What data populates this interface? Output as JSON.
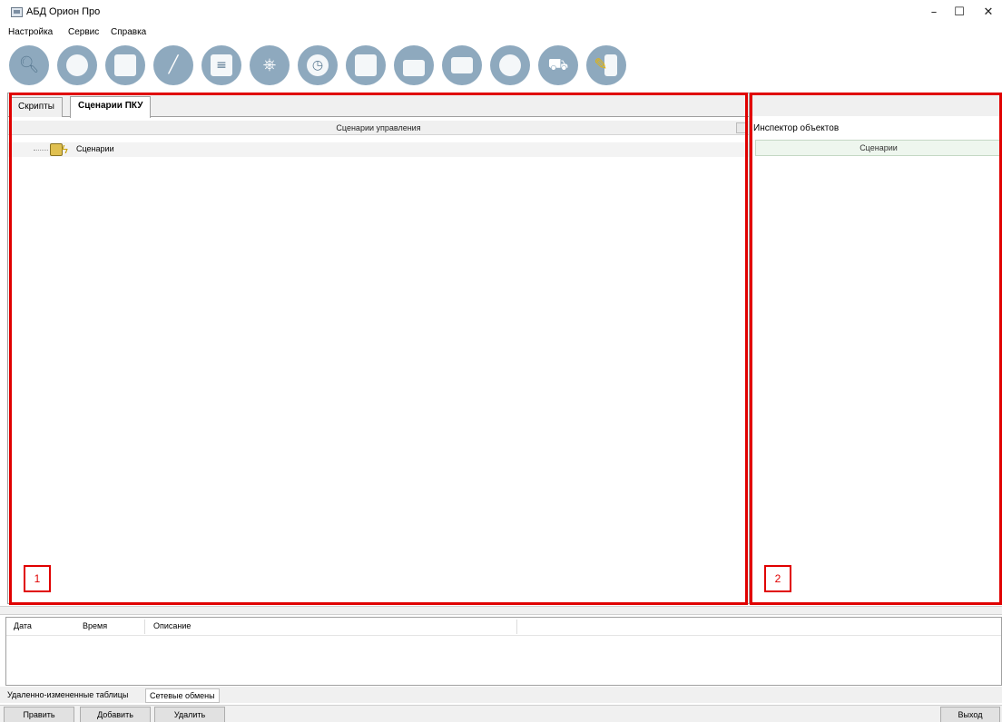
{
  "window": {
    "title": "АБД Орион Про",
    "icon": "database-icon",
    "controls": {
      "minimize": "–",
      "maximize": "☐",
      "close": "✕"
    }
  },
  "menu": {
    "items": [
      {
        "label": "Настройка"
      },
      {
        "label": "Сервис"
      },
      {
        "label": "Справка"
      }
    ]
  },
  "toolbar": {
    "buttons": [
      {
        "icon": "search-icon"
      },
      {
        "icon": "cards-icon"
      },
      {
        "icon": "devices-icon"
      },
      {
        "icon": "barrier-icon"
      },
      {
        "icon": "document-list-icon",
        "active": true
      },
      {
        "icon": "wheel-icon"
      },
      {
        "icon": "schedule-clock-icon"
      },
      {
        "icon": "calendar-icon"
      },
      {
        "icon": "lock-icon"
      },
      {
        "icon": "employee-card-icon"
      },
      {
        "icon": "employees-icon"
      },
      {
        "icon": "car-icon"
      },
      {
        "icon": "key-icon"
      }
    ]
  },
  "left_panel": {
    "tabs": [
      {
        "label": "Скрипты",
        "active": false
      },
      {
        "label": "Сценарии ПКУ",
        "active": true
      }
    ],
    "column_header": "Сценарии управления",
    "tree": [
      {
        "label": "Сценарии",
        "icon": "scenario-folder-icon"
      }
    ]
  },
  "right_panel": {
    "title": "Инспектор объектов",
    "subheader": "Сценарии"
  },
  "annotations": [
    {
      "label": "1"
    },
    {
      "label": "2"
    }
  ],
  "log": {
    "columns": [
      "Дата",
      "Время",
      "Описание"
    ]
  },
  "bottom_tabs": [
    {
      "label": "Удаленно-измененные таблицы"
    },
    {
      "label": "Сетевые обмены"
    }
  ],
  "buttons": {
    "edit": "Править",
    "add": "Добавить",
    "delete": "Удалить",
    "exit": "Выход"
  },
  "colors": {
    "toolbar_icon": "#8ea9be",
    "annotation": "#e00000"
  }
}
